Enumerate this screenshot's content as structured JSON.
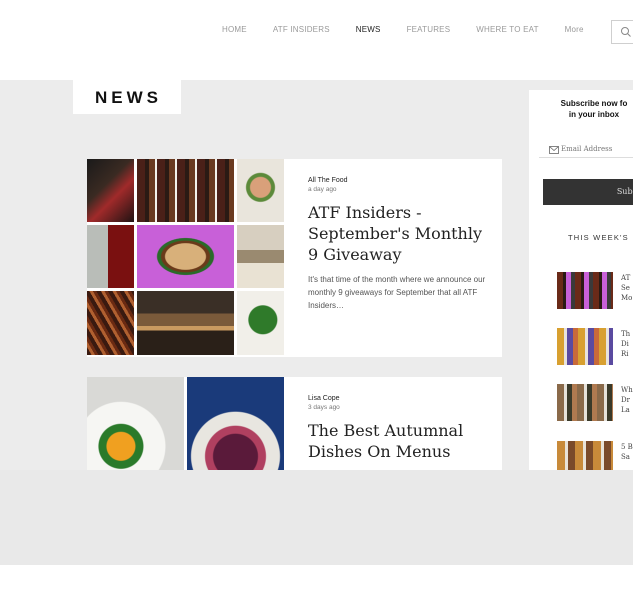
{
  "nav": {
    "items": [
      "HOME",
      "ATF INSIDERS",
      "NEWS",
      "FEATURES",
      "WHERE TO EAT",
      "More"
    ],
    "active": "NEWS"
  },
  "page": {
    "title": "NEWS"
  },
  "articles": [
    {
      "author": "All The Food",
      "date": "a day ago",
      "title": "ATF Insiders - September's Monthly 9 Giveaway",
      "excerpt": "It's that time of the month where we announce our monthly 9 giveaways for September that all ATF Insiders…"
    },
    {
      "author": "Lisa Cope",
      "date": "3 days ago",
      "title": "The Best Autumnal Dishes On Menus",
      "excerpt": ""
    }
  ],
  "sidebar": {
    "subscribe_line1": "Subscribe now fo",
    "subscribe_line2": "in your inbox",
    "email_placeholder": "Email Address",
    "subscribe_button": "Subscr",
    "week_title": "THIS WEEK'S",
    "items": [
      {
        "l1": "AT",
        "l2": "Se",
        "l3": "Mo"
      },
      {
        "l1": "Th",
        "l2": "Di",
        "l3": "Ri"
      },
      {
        "l1": "Wh",
        "l2": "Dr",
        "l3": "La"
      },
      {
        "l1": "5 B",
        "l2": "Sa",
        "l3": ""
      }
    ]
  },
  "colors": {
    "main_bg": "#ececec",
    "dark_button": "#333333"
  }
}
